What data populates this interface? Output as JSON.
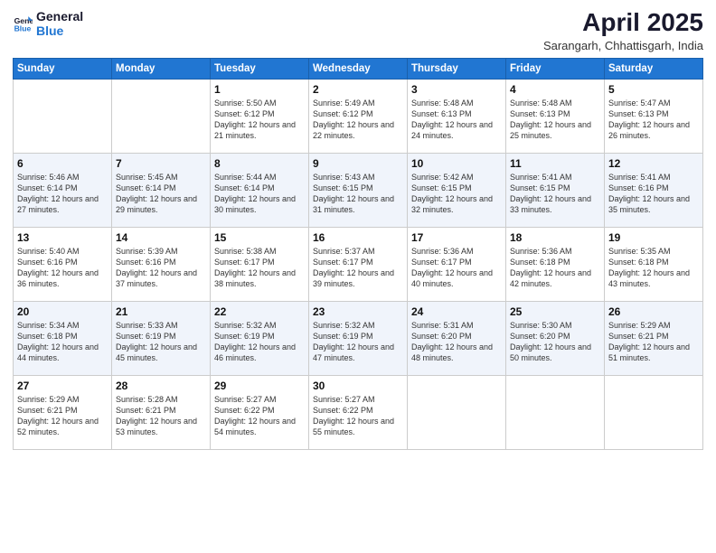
{
  "logo": {
    "text_general": "General",
    "text_blue": "Blue"
  },
  "title": "April 2025",
  "subtitle": "Sarangarh, Chhattisgarh, India",
  "days_of_week": [
    "Sunday",
    "Monday",
    "Tuesday",
    "Wednesday",
    "Thursday",
    "Friday",
    "Saturday"
  ],
  "weeks": [
    [
      {
        "day": "",
        "sunrise": "",
        "sunset": "",
        "daylight": ""
      },
      {
        "day": "",
        "sunrise": "",
        "sunset": "",
        "daylight": ""
      },
      {
        "day": "1",
        "sunrise": "Sunrise: 5:50 AM",
        "sunset": "Sunset: 6:12 PM",
        "daylight": "Daylight: 12 hours and 21 minutes."
      },
      {
        "day": "2",
        "sunrise": "Sunrise: 5:49 AM",
        "sunset": "Sunset: 6:12 PM",
        "daylight": "Daylight: 12 hours and 22 minutes."
      },
      {
        "day": "3",
        "sunrise": "Sunrise: 5:48 AM",
        "sunset": "Sunset: 6:13 PM",
        "daylight": "Daylight: 12 hours and 24 minutes."
      },
      {
        "day": "4",
        "sunrise": "Sunrise: 5:48 AM",
        "sunset": "Sunset: 6:13 PM",
        "daylight": "Daylight: 12 hours and 25 minutes."
      },
      {
        "day": "5",
        "sunrise": "Sunrise: 5:47 AM",
        "sunset": "Sunset: 6:13 PM",
        "daylight": "Daylight: 12 hours and 26 minutes."
      }
    ],
    [
      {
        "day": "6",
        "sunrise": "Sunrise: 5:46 AM",
        "sunset": "Sunset: 6:14 PM",
        "daylight": "Daylight: 12 hours and 27 minutes."
      },
      {
        "day": "7",
        "sunrise": "Sunrise: 5:45 AM",
        "sunset": "Sunset: 6:14 PM",
        "daylight": "Daylight: 12 hours and 29 minutes."
      },
      {
        "day": "8",
        "sunrise": "Sunrise: 5:44 AM",
        "sunset": "Sunset: 6:14 PM",
        "daylight": "Daylight: 12 hours and 30 minutes."
      },
      {
        "day": "9",
        "sunrise": "Sunrise: 5:43 AM",
        "sunset": "Sunset: 6:15 PM",
        "daylight": "Daylight: 12 hours and 31 minutes."
      },
      {
        "day": "10",
        "sunrise": "Sunrise: 5:42 AM",
        "sunset": "Sunset: 6:15 PM",
        "daylight": "Daylight: 12 hours and 32 minutes."
      },
      {
        "day": "11",
        "sunrise": "Sunrise: 5:41 AM",
        "sunset": "Sunset: 6:15 PM",
        "daylight": "Daylight: 12 hours and 33 minutes."
      },
      {
        "day": "12",
        "sunrise": "Sunrise: 5:41 AM",
        "sunset": "Sunset: 6:16 PM",
        "daylight": "Daylight: 12 hours and 35 minutes."
      }
    ],
    [
      {
        "day": "13",
        "sunrise": "Sunrise: 5:40 AM",
        "sunset": "Sunset: 6:16 PM",
        "daylight": "Daylight: 12 hours and 36 minutes."
      },
      {
        "day": "14",
        "sunrise": "Sunrise: 5:39 AM",
        "sunset": "Sunset: 6:16 PM",
        "daylight": "Daylight: 12 hours and 37 minutes."
      },
      {
        "day": "15",
        "sunrise": "Sunrise: 5:38 AM",
        "sunset": "Sunset: 6:17 PM",
        "daylight": "Daylight: 12 hours and 38 minutes."
      },
      {
        "day": "16",
        "sunrise": "Sunrise: 5:37 AM",
        "sunset": "Sunset: 6:17 PM",
        "daylight": "Daylight: 12 hours and 39 minutes."
      },
      {
        "day": "17",
        "sunrise": "Sunrise: 5:36 AM",
        "sunset": "Sunset: 6:17 PM",
        "daylight": "Daylight: 12 hours and 40 minutes."
      },
      {
        "day": "18",
        "sunrise": "Sunrise: 5:36 AM",
        "sunset": "Sunset: 6:18 PM",
        "daylight": "Daylight: 12 hours and 42 minutes."
      },
      {
        "day": "19",
        "sunrise": "Sunrise: 5:35 AM",
        "sunset": "Sunset: 6:18 PM",
        "daylight": "Daylight: 12 hours and 43 minutes."
      }
    ],
    [
      {
        "day": "20",
        "sunrise": "Sunrise: 5:34 AM",
        "sunset": "Sunset: 6:18 PM",
        "daylight": "Daylight: 12 hours and 44 minutes."
      },
      {
        "day": "21",
        "sunrise": "Sunrise: 5:33 AM",
        "sunset": "Sunset: 6:19 PM",
        "daylight": "Daylight: 12 hours and 45 minutes."
      },
      {
        "day": "22",
        "sunrise": "Sunrise: 5:32 AM",
        "sunset": "Sunset: 6:19 PM",
        "daylight": "Daylight: 12 hours and 46 minutes."
      },
      {
        "day": "23",
        "sunrise": "Sunrise: 5:32 AM",
        "sunset": "Sunset: 6:19 PM",
        "daylight": "Daylight: 12 hours and 47 minutes."
      },
      {
        "day": "24",
        "sunrise": "Sunrise: 5:31 AM",
        "sunset": "Sunset: 6:20 PM",
        "daylight": "Daylight: 12 hours and 48 minutes."
      },
      {
        "day": "25",
        "sunrise": "Sunrise: 5:30 AM",
        "sunset": "Sunset: 6:20 PM",
        "daylight": "Daylight: 12 hours and 50 minutes."
      },
      {
        "day": "26",
        "sunrise": "Sunrise: 5:29 AM",
        "sunset": "Sunset: 6:21 PM",
        "daylight": "Daylight: 12 hours and 51 minutes."
      }
    ],
    [
      {
        "day": "27",
        "sunrise": "Sunrise: 5:29 AM",
        "sunset": "Sunset: 6:21 PM",
        "daylight": "Daylight: 12 hours and 52 minutes."
      },
      {
        "day": "28",
        "sunrise": "Sunrise: 5:28 AM",
        "sunset": "Sunset: 6:21 PM",
        "daylight": "Daylight: 12 hours and 53 minutes."
      },
      {
        "day": "29",
        "sunrise": "Sunrise: 5:27 AM",
        "sunset": "Sunset: 6:22 PM",
        "daylight": "Daylight: 12 hours and 54 minutes."
      },
      {
        "day": "30",
        "sunrise": "Sunrise: 5:27 AM",
        "sunset": "Sunset: 6:22 PM",
        "daylight": "Daylight: 12 hours and 55 minutes."
      },
      {
        "day": "",
        "sunrise": "",
        "sunset": "",
        "daylight": ""
      },
      {
        "day": "",
        "sunrise": "",
        "sunset": "",
        "daylight": ""
      },
      {
        "day": "",
        "sunrise": "",
        "sunset": "",
        "daylight": ""
      }
    ]
  ]
}
